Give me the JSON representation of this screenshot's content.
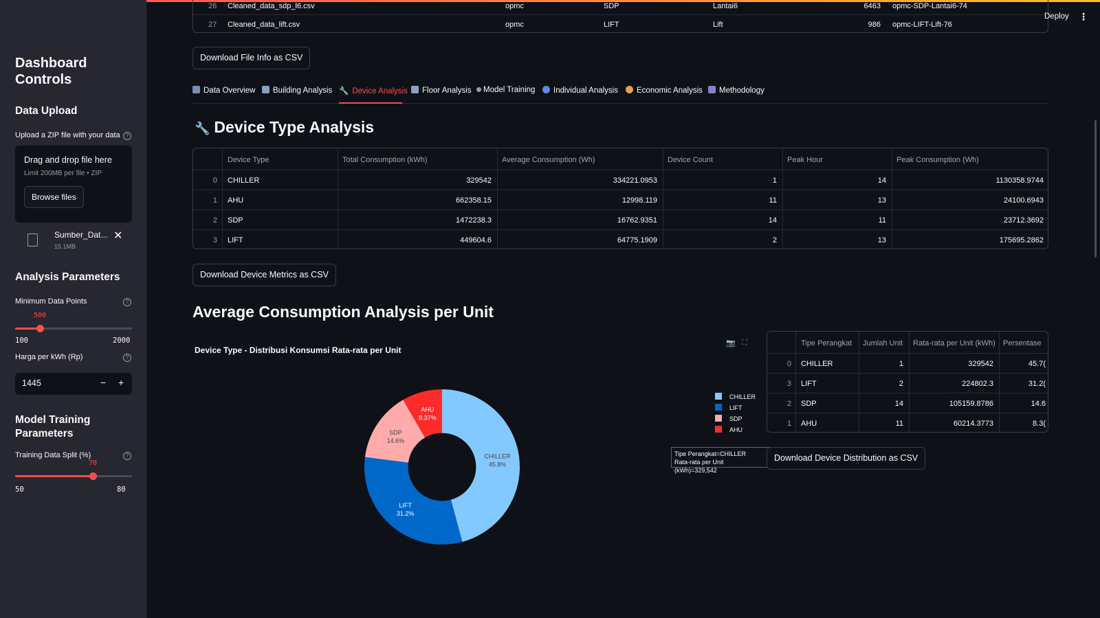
{
  "sidebar": {
    "title": "Dashboard Controls",
    "data_upload_heading": "Data Upload",
    "upload_label": "Upload a ZIP file with your data",
    "drop_text": "Drag and drop file here",
    "limit_text": "Limit 200MB per file • ZIP",
    "browse_label": "Browse files",
    "file_name": "Sumber_Dat...",
    "file_size": "15.1MB",
    "analysis_heading": "Analysis Parameters",
    "min_points_label": "Minimum Data Points",
    "min_points_value": "500",
    "min_points_min": "100",
    "min_points_max": "2000",
    "min_points_fraction": 0.21,
    "price_label": "Harga per kWh (Rp)",
    "price_value": "1445",
    "minus": "−",
    "plus": "+",
    "model_heading": "Model Training Parameters",
    "split_label": "Training Data Split (%)",
    "split_value": "70",
    "split_min": "50",
    "split_max": "80",
    "split_fraction": 0.667
  },
  "header": {
    "deploy_label": "Deploy",
    "menu_icon": "⋮"
  },
  "file_table": {
    "rows": [
      {
        "idx": "26",
        "file": "Cleaned_data_sdp_l6.csv",
        "building": "opmc",
        "device": "SDP",
        "floor": "Lantai6",
        "count": "6463",
        "id": "opmc-SDP-Lantai6-74"
      },
      {
        "idx": "27",
        "file": "Cleaned_data_lift.csv",
        "building": "opmc",
        "device": "LIFT",
        "floor": "Lift",
        "count": "986",
        "id": "opmc-LIFT-Lift-76"
      }
    ]
  },
  "download_file_info": "Download File Info as CSV",
  "tabs": [
    {
      "label": "Data Overview",
      "color": "#7a8fb0"
    },
    {
      "label": "Building Analysis",
      "color": "#8aa1c7"
    },
    {
      "label": "Device Analysis",
      "color": "#c0c0c0"
    },
    {
      "label": "Floor Analysis",
      "color": "#8aa1c7"
    },
    {
      "label": "Model Training",
      "color": "#9a9ca3"
    },
    {
      "label": "Individual Analysis",
      "color": "#5d8fd8"
    },
    {
      "label": "Economic Analysis",
      "color": "#e0a64a"
    },
    {
      "label": "Methodology",
      "color": "#8a7fc7"
    }
  ],
  "device_heading": "Device Type Analysis",
  "device_table": {
    "headers": [
      "Device Type",
      "Total Consumption (kWh)",
      "Average Consumption (Wh)",
      "Device Count",
      "Peak Hour",
      "Peak Consumption (Wh)"
    ],
    "rows": [
      [
        "0",
        "CHILLER",
        "329542",
        "334221.0953",
        "1",
        "14",
        "1130358.9744"
      ],
      [
        "1",
        "AHU",
        "662358.15",
        "12998.119",
        "11",
        "13",
        "24100.6943"
      ],
      [
        "2",
        "SDP",
        "1472238.3",
        "16762.9351",
        "14",
        "11",
        "23712.3692"
      ],
      [
        "3",
        "LIFT",
        "449604.6",
        "64775.1909",
        "2",
        "13",
        "175695.2862"
      ]
    ]
  },
  "download_device_metrics": "Download Device Metrics as CSV",
  "avg_heading": "Average Consumption Analysis per Unit",
  "chart_data": {
    "type": "pie",
    "title": "Device Type - Distribusi Konsumsi Rata-rata per Unit",
    "hole": 0.35,
    "slices": [
      {
        "label": "CHILLER",
        "percent": "45.8%",
        "value": 45.8,
        "color": "#83c9ff"
      },
      {
        "label": "LIFT",
        "percent": "31.2%",
        "value": 31.2,
        "color": "#0068c9"
      },
      {
        "label": "SDP",
        "percent": "14.6%",
        "value": 14.6,
        "color": "#ffabab"
      },
      {
        "label": "AHU",
        "percent": "8.37%",
        "value": 8.37,
        "color": "#ff2b2b"
      }
    ],
    "legend": [
      "CHILLER",
      "LIFT",
      "SDP",
      "AHU"
    ],
    "legend_position": "right",
    "tooltip_line1": "Tipe Perangkat=CHILLER",
    "tooltip_line2": "Rata-rata per Unit (kWh)=329,542"
  },
  "unit_table": {
    "headers": [
      "Tipe Perangkat",
      "Jumlah Unit",
      "Rata-rata per Unit (kWh)",
      "Persentase"
    ],
    "rows": [
      [
        "0",
        "CHILLER",
        "1",
        "329542",
        "45.7("
      ],
      [
        "3",
        "LIFT",
        "2",
        "224802.3",
        "31.2("
      ],
      [
        "2",
        "SDP",
        "14",
        "105159.8786",
        "14.6"
      ],
      [
        "1",
        "AHU",
        "11",
        "60214.3773",
        "8.3("
      ]
    ]
  },
  "download_distribution": "Download Device Distribution as CSV",
  "icons": {
    "camera": "📷",
    "expand": "⛶",
    "wrench": "🔧",
    "close": "✕"
  }
}
